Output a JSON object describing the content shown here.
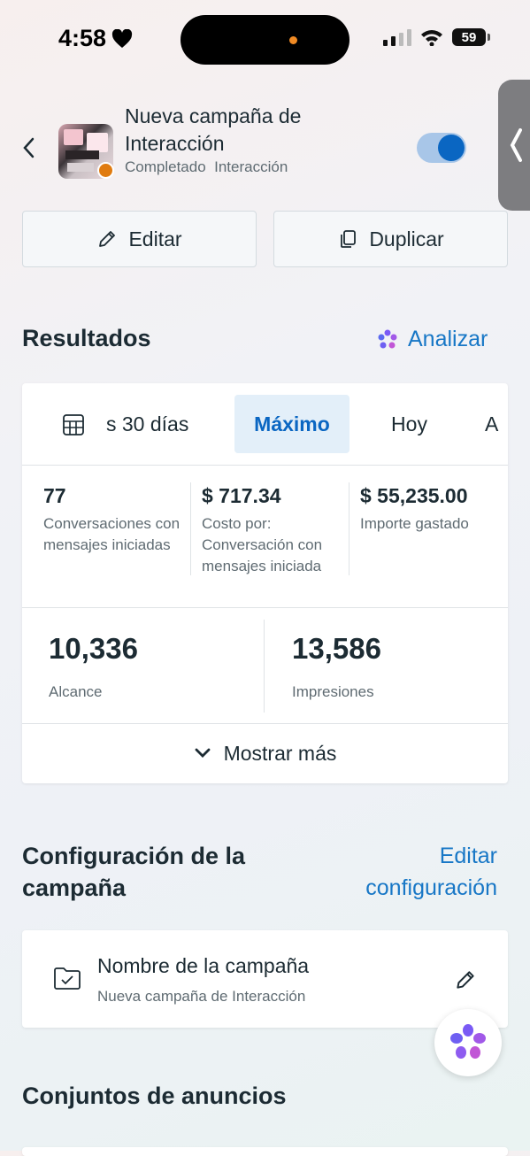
{
  "status_bar": {
    "time": "4:58",
    "battery": "59"
  },
  "campaign": {
    "title": "Nueva campaña de Interacción",
    "status": "Completado",
    "objective": "Interacción",
    "enabled": true
  },
  "actions": {
    "edit_label": "Editar",
    "duplicate_label": "Duplicar"
  },
  "results": {
    "title": "Resultados",
    "analyze_label": "Analizar",
    "tabs": [
      {
        "label": "s 30 días"
      },
      {
        "label": "Máximo",
        "active": true
      },
      {
        "label": "Hoy"
      },
      {
        "label": "A"
      }
    ],
    "metrics": [
      {
        "value": "77",
        "label": "Conversaciones con mensajes iniciadas"
      },
      {
        "value": "$ 717.34",
        "label": "Costo por: Conversación con mensajes iniciada"
      },
      {
        "value": "$ 55,235.00",
        "label": "Importe gastado"
      }
    ],
    "reach": {
      "value": "10,336",
      "label": "Alcance"
    },
    "impressions": {
      "value": "13,586",
      "label": "Impresiones"
    },
    "show_more_label": "Mostrar más"
  },
  "config": {
    "title_line1": "Configuración de la",
    "title_line2": "campaña",
    "edit_line1": "Editar",
    "edit_line2": "configuración",
    "name_label": "Nombre de la campaña",
    "name_value": "Nueva campaña de Interacción"
  },
  "ad_sets": {
    "title": "Conjuntos de anuncios"
  },
  "colors": {
    "accent": "#0a66c2",
    "link": "#1777c6",
    "warning_dot": "#e07b10"
  }
}
